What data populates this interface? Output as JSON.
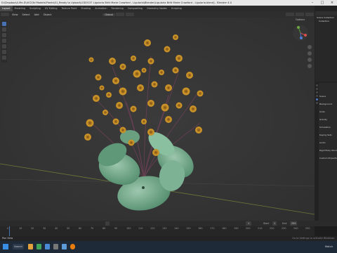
{
  "window": {
    "title": "D:\\Dropbox\\4-Me-D\\4V2\\3d Models\\Plants\\01_Ready to Upload\\LGD0137 Ligularia Britt Marie Crawford - Ligularia\\Blender\\Ligularia Britt Marie Crawford - Ligularia.blend] - Blender 4.0"
  },
  "menubar": {
    "workspaces": [
      "Layout",
      "Modeling",
      "Sculpting",
      "UV Editing",
      "Texture Paint",
      "Shading",
      "Animation",
      "Rendering",
      "Compositing",
      "Geometry Nodes",
      "Scripting"
    ],
    "active_workspace": "Layout",
    "scene_label": "Scene"
  },
  "header": {
    "view": "View",
    "select": "Select",
    "add": "Add",
    "object": "Object",
    "transform": "Global",
    "options": "Options"
  },
  "outliner": {
    "items": [
      "Scene Collection",
      "Collection"
    ]
  },
  "properties": {
    "items": [
      "Scene",
      "Background",
      "Units",
      "Gravity",
      "Simulation",
      "Keying Sets",
      "Audio",
      "Rigid Body World",
      "Custom Properties"
    ]
  },
  "timeline": {
    "current_frame": "1",
    "start_label": "Start",
    "start": "1",
    "end_label": "End",
    "end": "250",
    "ticks": [
      "0",
      "10",
      "20",
      "30",
      "40",
      "50",
      "60",
      "70",
      "80",
      "90",
      "100",
      "110",
      "120",
      "130",
      "140",
      "150",
      "160",
      "170",
      "180",
      "190",
      "200",
      "210",
      "220",
      "230",
      "240",
      "250"
    ]
  },
  "statusbar": {
    "left": "Pan View",
    "right": "Go to Settings to activate Windows."
  },
  "taskbar": {
    "search": "Search",
    "right_label": "Match"
  },
  "colors": {
    "viewport_bg": "#393939",
    "flower": "#c98a1f",
    "leaf": "#6fa889",
    "accent": "#4772b3"
  }
}
